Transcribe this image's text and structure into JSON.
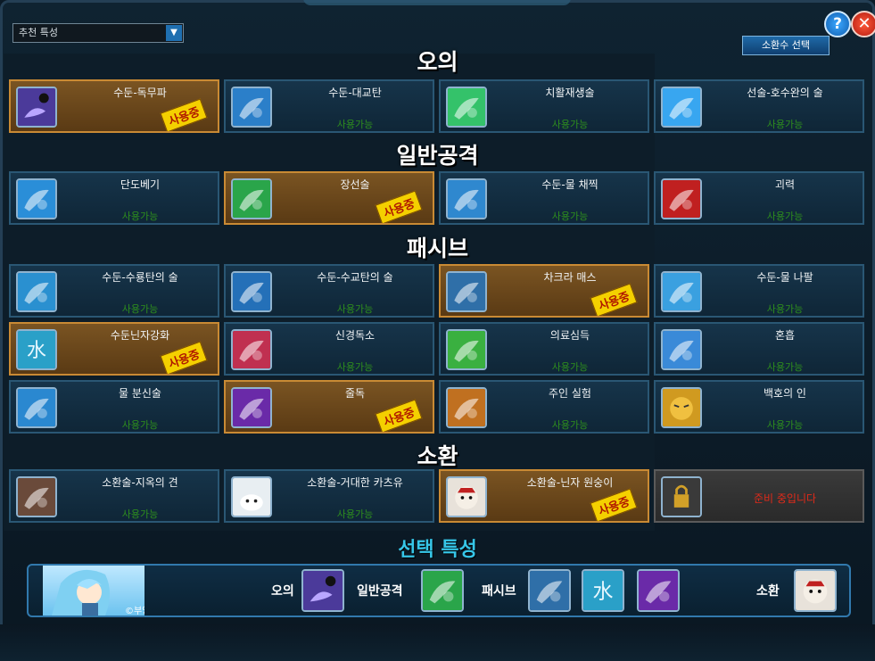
{
  "dropdown": {
    "value": "추천 특성"
  },
  "buttons": {
    "help": "?",
    "close": "✕",
    "summon_select": "소환수 선택"
  },
  "sections": [
    {
      "key": "ougi",
      "title": "오의",
      "cards": [
        {
          "name": "수둔-독무파",
          "status": "사용중",
          "active": true,
          "icon": "poison-mist-icon",
          "color": "#4b3a9a"
        },
        {
          "name": "수둔-대교탄",
          "status": "사용가능",
          "active": false,
          "icon": "shark-icon",
          "color": "#2b7fc9"
        },
        {
          "name": "치활재생술",
          "status": "사용가능",
          "active": false,
          "icon": "healing-hand-icon",
          "color": "#34c26a"
        },
        {
          "name": "선술-호수완의 술",
          "status": "사용가능",
          "active": false,
          "icon": "water-arm-icon",
          "color": "#38a6f0"
        }
      ]
    },
    {
      "key": "basic",
      "title": "일반공격",
      "cards": [
        {
          "name": "단도베기",
          "status": "사용가능",
          "active": false,
          "icon": "fist-icon",
          "color": "#2a8ed8"
        },
        {
          "name": "장선술",
          "status": "사용중",
          "active": true,
          "icon": "green-palm-icon",
          "color": "#2aa54a"
        },
        {
          "name": "수둔-물 채찍",
          "status": "사용가능",
          "active": false,
          "icon": "water-whip-icon",
          "color": "#2f88cf"
        },
        {
          "name": "괴력",
          "status": "사용가능",
          "active": false,
          "icon": "red-fist-icon",
          "color": "#c02020"
        }
      ]
    },
    {
      "key": "passive",
      "title": "패시브",
      "cards": [
        {
          "name": "수둔-수룡탄의 술",
          "status": "사용가능",
          "active": false,
          "icon": "water-dragon-icon",
          "color": "#2a90d0"
        },
        {
          "name": "수둔-수교탄의 술",
          "status": "사용가능",
          "active": false,
          "icon": "water-shark-icon",
          "color": "#2470b8"
        },
        {
          "name": "차크라 매스",
          "status": "사용중",
          "active": true,
          "icon": "chakra-glove-icon",
          "color": "#2f6fa8"
        },
        {
          "name": "수둔-물 나팔",
          "status": "사용가능",
          "active": false,
          "icon": "ice-spikes-icon",
          "color": "#3aa0e0"
        },
        {
          "name": "수둔닌자강화",
          "status": "사용중",
          "active": true,
          "icon": "water-kanji-icon",
          "color": "#2aa0c8"
        },
        {
          "name": "신경독소",
          "status": "사용가능",
          "active": false,
          "icon": "brain-icon",
          "color": "#c03050"
        },
        {
          "name": "의료심득",
          "status": "사용가능",
          "active": false,
          "icon": "medical-scroll-icon",
          "color": "#3ab040"
        },
        {
          "name": "혼흡",
          "status": "사용가능",
          "active": false,
          "icon": "blue-palm-icon",
          "color": "#3a8ad8"
        },
        {
          "name": "물 분신술",
          "status": "사용가능",
          "active": false,
          "icon": "water-clone-icon",
          "color": "#2a88d0"
        },
        {
          "name": "줄독",
          "status": "사용중",
          "active": true,
          "icon": "purple-blade-icon",
          "color": "#6a2aa8"
        },
        {
          "name": "주인 실험",
          "status": "사용가능",
          "active": false,
          "icon": "beast-face-icon",
          "color": "#c07020"
        },
        {
          "name": "백호의 인",
          "status": "사용가능",
          "active": false,
          "icon": "tiger-face-icon",
          "color": "#d09a20"
        }
      ]
    },
    {
      "key": "summon",
      "title": "소환",
      "cards": [
        {
          "name": "소환술-지옥의 견",
          "status": "사용가능",
          "active": false,
          "icon": "hell-dog-icon",
          "color": "#6a4a3a"
        },
        {
          "name": "소환술-거대한 카츠유",
          "status": "사용가능",
          "active": false,
          "icon": "slug-icon",
          "color": "#e8eef2"
        },
        {
          "name": "소환술-닌자 원숭이",
          "status": "사용중",
          "active": true,
          "icon": "monkey-face-icon",
          "color": "#e8e2da"
        },
        {
          "name": "준비 중입니다",
          "status": "",
          "active": false,
          "locked": true,
          "icon": "lock-icon",
          "color": "#3a3a3a"
        }
      ]
    }
  ],
  "selected": {
    "title": "선택 특성",
    "credit": "©부엉새",
    "labels": {
      "ougi": "오의",
      "basic": "일반공격",
      "passive": "패시브",
      "summon": "소환"
    },
    "slots": [
      {
        "icon": "poison-mist-icon",
        "color": "#4b3a9a"
      },
      {
        "icon": "green-palm-icon",
        "color": "#2aa54a"
      },
      {
        "icon": "chakra-glove-icon",
        "color": "#2f6fa8"
      },
      {
        "icon": "water-kanji-icon",
        "color": "#2aa0c8"
      },
      {
        "icon": "purple-blade-icon",
        "color": "#6a2aa8"
      },
      {
        "icon": "monkey-face-icon",
        "color": "#e8e2da"
      }
    ]
  }
}
